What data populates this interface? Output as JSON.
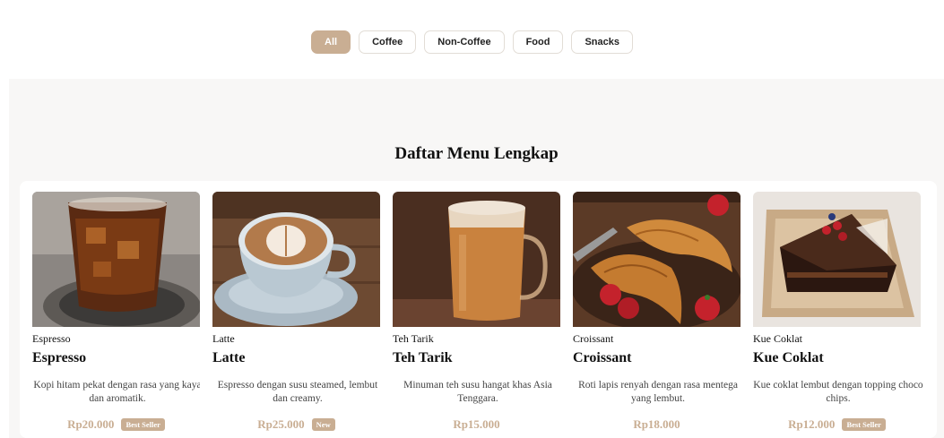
{
  "filters": [
    {
      "label": "All",
      "active": true
    },
    {
      "label": "Coffee",
      "active": false
    },
    {
      "label": "Non-Coffee",
      "active": false
    },
    {
      "label": "Food",
      "active": false
    },
    {
      "label": "Snacks",
      "active": false
    }
  ],
  "section": {
    "title": "Daftar Menu Lengkap"
  },
  "accent_color": "#c9ae93",
  "items": [
    {
      "category": "Espresso",
      "name": "Espresso",
      "description": "Kopi hitam pekat dengan rasa yang kaya dan aromatik.",
      "price": "Rp20.000",
      "badge": "Best Seller"
    },
    {
      "category": "Latte",
      "name": "Latte",
      "description": "Espresso dengan susu steamed, lembut dan creamy.",
      "price": "Rp25.000",
      "badge": "New"
    },
    {
      "category": "Teh Tarik",
      "name": "Teh Tarik",
      "description": "Minuman teh susu hangat khas Asia Tenggara.",
      "price": "Rp15.000",
      "badge": ""
    },
    {
      "category": "Croissant",
      "name": "Croissant",
      "description": "Roti lapis renyah dengan rasa mentega yang lembut.",
      "price": "Rp18.000",
      "badge": ""
    },
    {
      "category": "Kue Coklat",
      "name": "Kue Coklat",
      "description": "Kue coklat lembut dengan topping choco chips.",
      "price": "Rp12.000",
      "badge": "Best Seller"
    }
  ]
}
